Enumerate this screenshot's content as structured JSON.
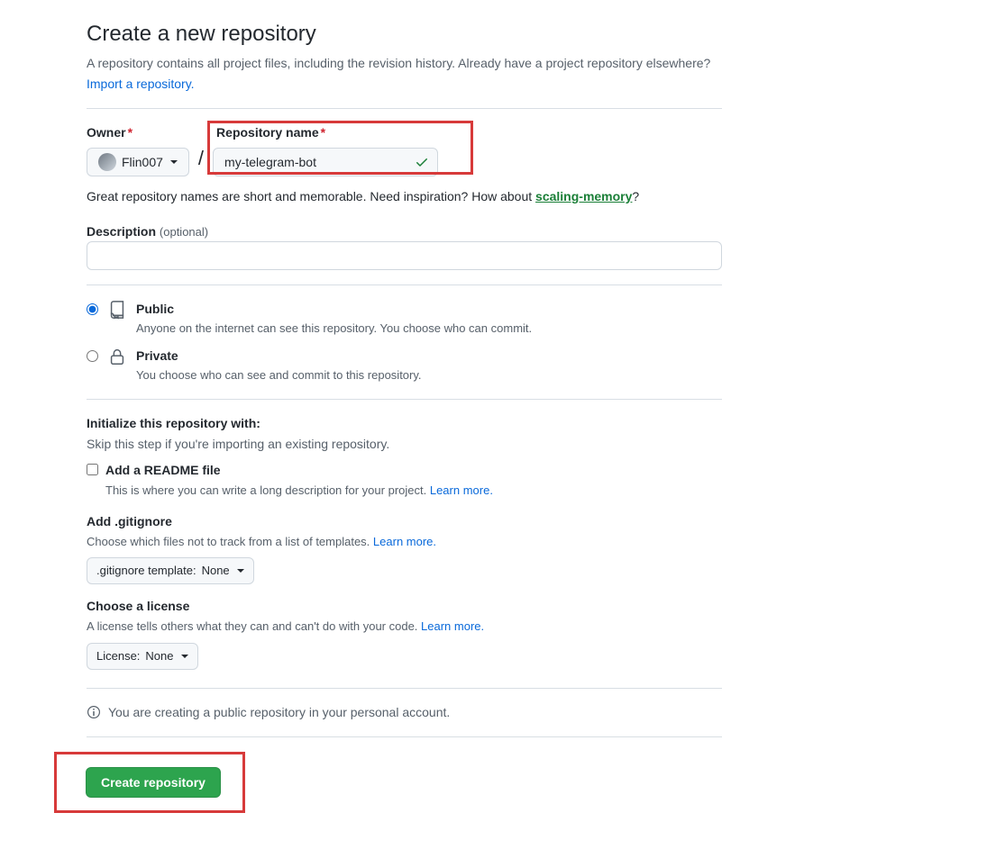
{
  "header": {
    "title": "Create a new repository",
    "subtitle": "A repository contains all project files, including the revision history. Already have a project repository elsewhere?",
    "import_link": "Import a repository."
  },
  "owner": {
    "label": "Owner",
    "value": "Flin007"
  },
  "repo_name": {
    "label": "Repository name",
    "value": "my-telegram-bot"
  },
  "hint": {
    "prefix": "Great repository names are short and memorable. Need inspiration? How about ",
    "suggestion": "scaling-memory",
    "suffix": "?"
  },
  "description": {
    "label": "Description",
    "optional": "(optional)",
    "value": ""
  },
  "visibility": {
    "public": {
      "title": "Public",
      "sub": "Anyone on the internet can see this repository. You choose who can commit."
    },
    "private": {
      "title": "Private",
      "sub": "You choose who can see and commit to this repository."
    }
  },
  "init": {
    "title": "Initialize this repository with:",
    "sub": "Skip this step if you're importing an existing repository."
  },
  "readme": {
    "label": "Add a README file",
    "sub": "This is where you can write a long description for your project. ",
    "learn": "Learn more."
  },
  "gitignore": {
    "label": "Add .gitignore",
    "sub": "Choose which files not to track from a list of templates. ",
    "learn": "Learn more.",
    "btn_prefix": ".gitignore template: ",
    "btn_value": "None"
  },
  "license": {
    "label": "Choose a license",
    "sub": "A license tells others what they can and can't do with your code. ",
    "learn": "Learn more.",
    "btn_prefix": "License: ",
    "btn_value": "None"
  },
  "info_text": "You are creating a public repository in your personal account.",
  "create_btn": "Create repository"
}
